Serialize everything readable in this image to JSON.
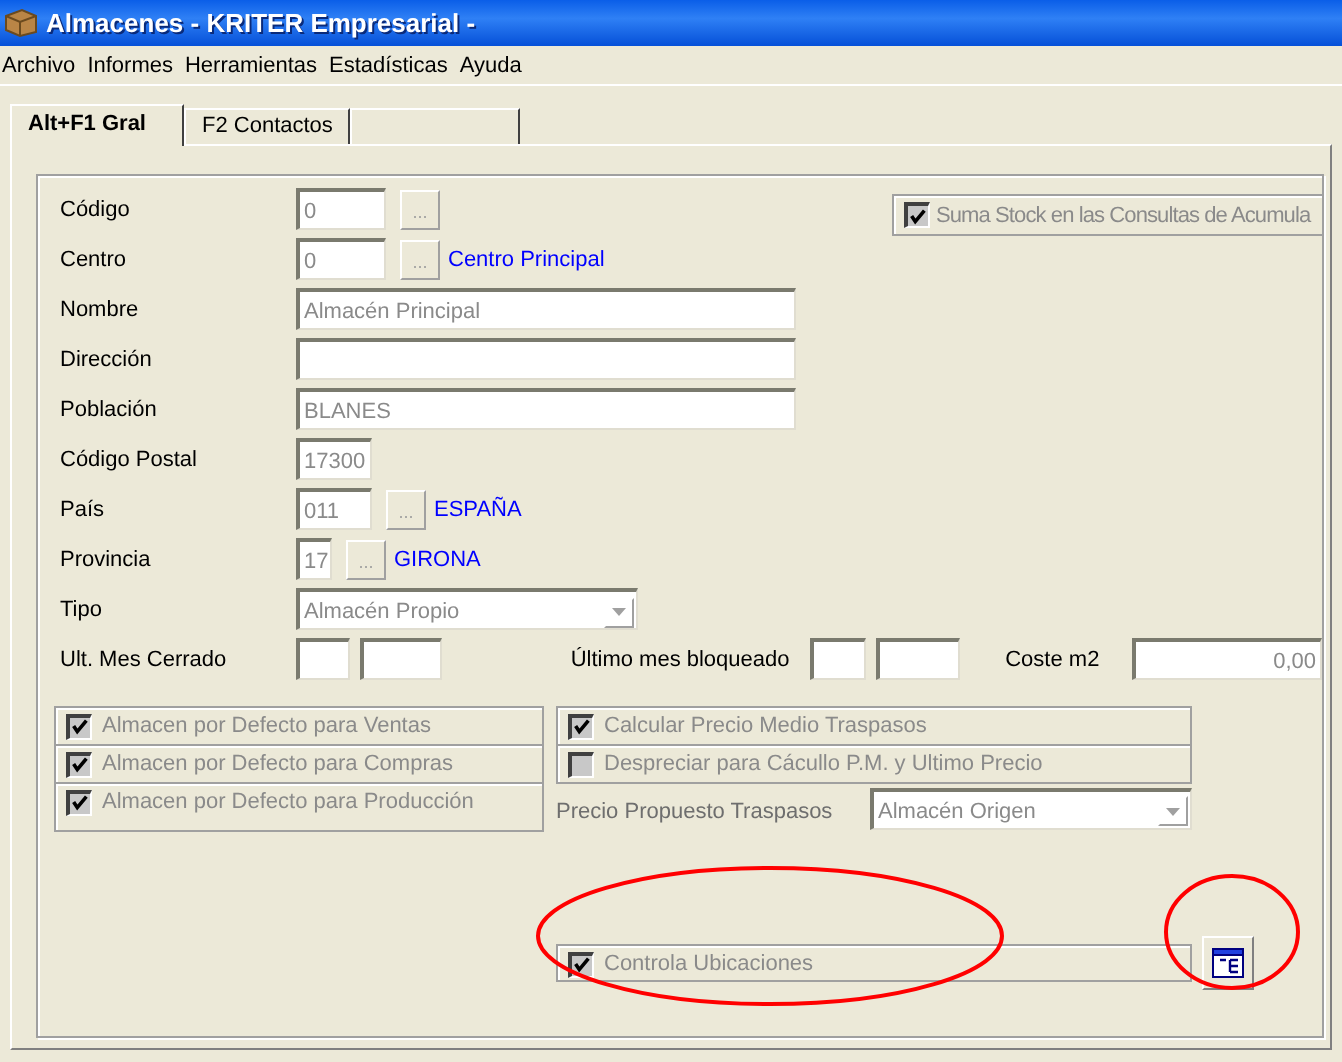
{
  "window": {
    "title": "Almacenes - KRITER Empresarial -"
  },
  "menu": [
    {
      "label": "Archivo"
    },
    {
      "label": "Informes"
    },
    {
      "label": "Herramientas"
    },
    {
      "label": "Estadísticas"
    },
    {
      "label": "Ayuda"
    }
  ],
  "tabs": [
    {
      "label": "Alt+F1 Gral",
      "selected": true
    },
    {
      "label": "F2 Contactos",
      "selected": false
    }
  ],
  "fields": [
    {
      "label": "Código",
      "kind": "lookup",
      "value": "0",
      "button": "...",
      "disabled": true
    },
    {
      "label": "Centro",
      "kind": "lookup",
      "value": "0",
      "button": "...",
      "link": "Centro Principal",
      "disabled": true
    },
    {
      "label": "Nombre",
      "kind": "text",
      "value": "Almacén Principal",
      "disabled": true
    },
    {
      "label": "Dirección",
      "kind": "text"
    },
    {
      "label": "Población",
      "kind": "text",
      "value": "BLANES",
      "disabled": true
    },
    {
      "label": "Código Postal",
      "kind": "short",
      "value": "17300",
      "disabled": true
    },
    {
      "label": "País",
      "kind": "lookup",
      "value": "011",
      "button": "...",
      "link": "ESPAÑA",
      "disabled": true
    },
    {
      "label": "Provincia",
      "kind": "lookup",
      "value": "17",
      "button": "...",
      "link": "GIRONA",
      "disabled": true
    },
    {
      "label": "Tipo",
      "kind": "combo",
      "value": "Almacén Propio",
      "disabled": true
    }
  ],
  "suma_stock": {
    "label": "Suma Stock en las Consultas de Acumula",
    "checked": true,
    "disabled": true
  },
  "periods": {
    "closed_label": "Ult. Mes Cerrado",
    "blocked_label": "Último mes bloqueado",
    "cost_label": "Coste m2",
    "cost_value": "0,00"
  },
  "default_checks": [
    {
      "label": "Almacen por Defecto para Ventas",
      "checked": true,
      "disabled": true
    },
    {
      "label": "Almacen por Defecto para Compras",
      "checked": true,
      "disabled": true
    },
    {
      "label": "Almacen por Defecto para Producción",
      "checked": true,
      "disabled": true
    }
  ],
  "transfer_checks": [
    {
      "label": "Calcular Precio Medio Traspasos",
      "checked": true,
      "disabled": true
    },
    {
      "label": "Despreciar para Cácullo P.M. y Ultimo Precio",
      "checked": false,
      "disabled": true
    }
  ],
  "transfer_price": {
    "label": "Precio Propuesto Traspasos",
    "value": "Almacén Origen",
    "disabled": true
  },
  "locations": {
    "label": "Controla Ubicaciones",
    "checked": true,
    "disabled": true
  }
}
